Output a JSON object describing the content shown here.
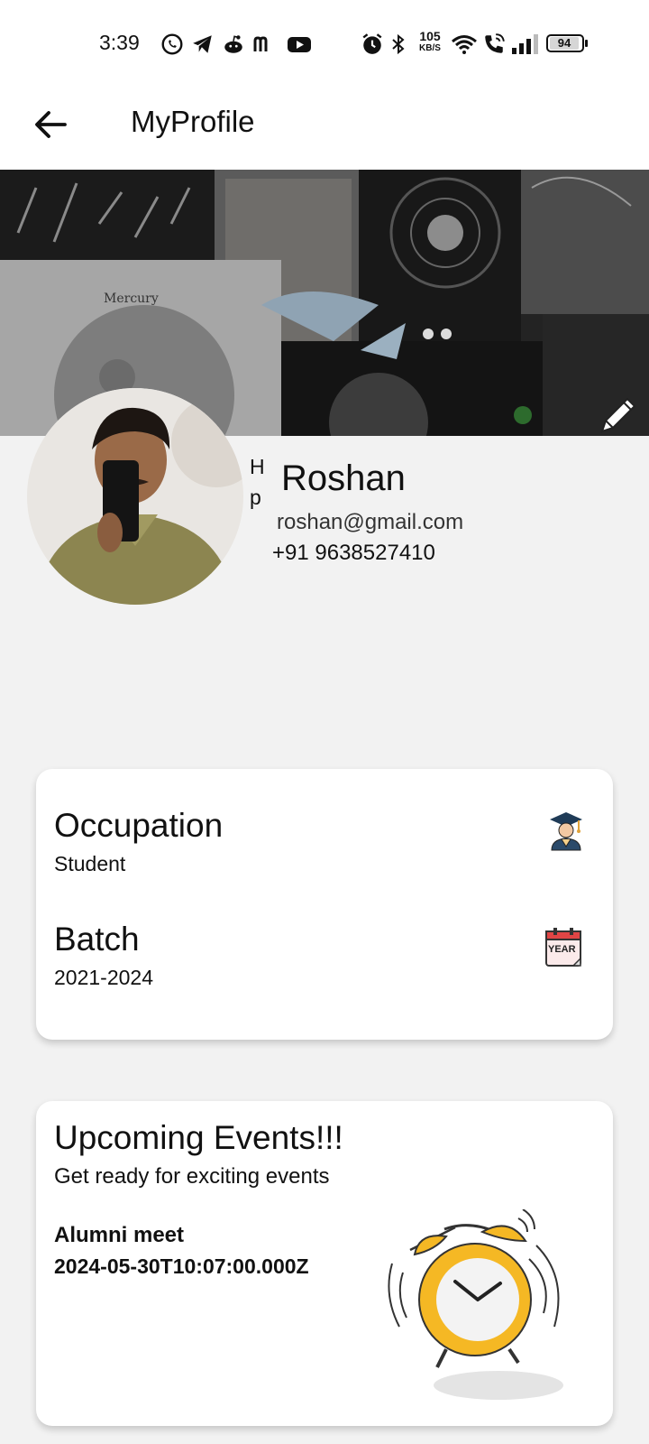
{
  "status_bar": {
    "time": "3:39",
    "net_speed_value": "105",
    "net_speed_unit": "KB/S",
    "battery": "94",
    "left_icons": [
      "whatsapp-icon",
      "telegram-icon",
      "reddit-icon",
      "m-app-icon",
      "youtube-icon"
    ],
    "right_icons": [
      "alarm-icon",
      "bluetooth-icon",
      "wifi-icon",
      "wifi-call-icon",
      "signal-icon",
      "battery-icon"
    ]
  },
  "app_bar": {
    "title": "MyProfile"
  },
  "cover": {
    "cover_text": "Mercury"
  },
  "profile": {
    "side_letters": [
      "H",
      "p"
    ],
    "name": "Roshan",
    "email": "roshan@gmail.com",
    "phone": "+91 9638527410"
  },
  "info_card": {
    "occupation_label": "Occupation",
    "occupation_value": "Student",
    "batch_label": "Batch",
    "batch_value": "2021-2024",
    "year_icon_text": "YEAR"
  },
  "events_card": {
    "title": "Upcoming Events!!!",
    "subtitle": "Get ready for exciting events",
    "event_name": "Alumni meet",
    "event_date": "2024-05-30T10:07:00.000Z"
  },
  "colors": {
    "clock_yellow": "#f5b824",
    "accent_dark": "#111111"
  }
}
